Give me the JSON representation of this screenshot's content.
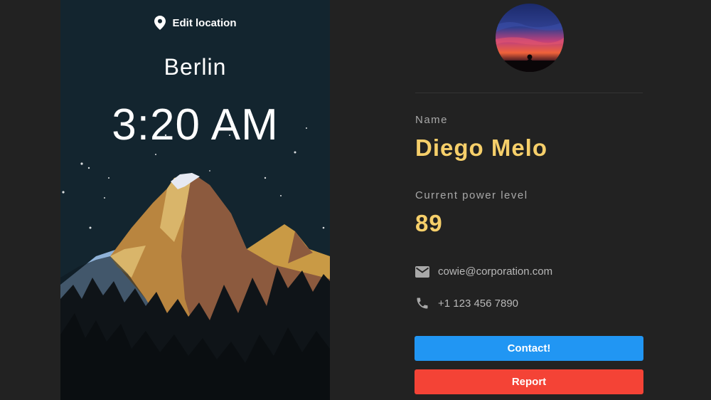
{
  "location": {
    "edit_label": "Edit location",
    "city": "Berlin",
    "time": "3:20 AM"
  },
  "profile": {
    "name_label": "Name",
    "name": "Diego Melo",
    "power_label": "Current power level",
    "power_level": "89",
    "email": "cowie@corporation.com",
    "phone": "+1 123 456 7890"
  },
  "actions": {
    "contact_label": "Contact!",
    "report_label": "Report"
  },
  "colors": {
    "accent_text": "#f6cf6a",
    "contact_button": "#2196f3",
    "report_button": "#f44336",
    "background": "#222222",
    "scene_sky": "#13252f"
  },
  "icons": {
    "location": "location-pin-icon",
    "email": "email-icon",
    "phone": "phone-icon"
  }
}
